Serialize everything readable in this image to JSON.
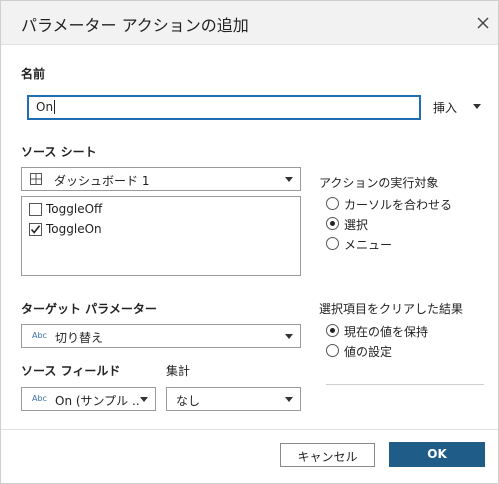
{
  "dialog": {
    "title": "パラメーター アクションの追加"
  },
  "name_section": {
    "label": "名前",
    "value": "On",
    "insert_label": "挿入"
  },
  "source_sheet": {
    "label": "ソース シート",
    "selected": "ダッシュボード 1",
    "sheets": [
      {
        "label": "ToggleOff",
        "checked": false
      },
      {
        "label": "ToggleOn",
        "checked": true
      }
    ]
  },
  "run_action_on": {
    "label": "アクションの実行対象",
    "options": [
      {
        "label": "カーソルを合わせる",
        "selected": false
      },
      {
        "label": "選択",
        "selected": true
      },
      {
        "label": "メニュー",
        "selected": false
      }
    ]
  },
  "target_parameter": {
    "label": "ターゲット パラメーター",
    "type_badge": "Abc",
    "selected": "切り替え"
  },
  "clearing_selection": {
    "label": "選択項目をクリアした結果",
    "options": [
      {
        "label": "現在の値を保持",
        "selected": true
      },
      {
        "label": "値の設定",
        "selected": false
      }
    ]
  },
  "source_field": {
    "label": "ソース フィールド",
    "type_badge": "Abc",
    "selected": "On (サンプル ..."
  },
  "aggregation": {
    "label": "集計",
    "selected": "なし"
  },
  "buttons": {
    "cancel": "キャンセル",
    "ok": "OK"
  }
}
